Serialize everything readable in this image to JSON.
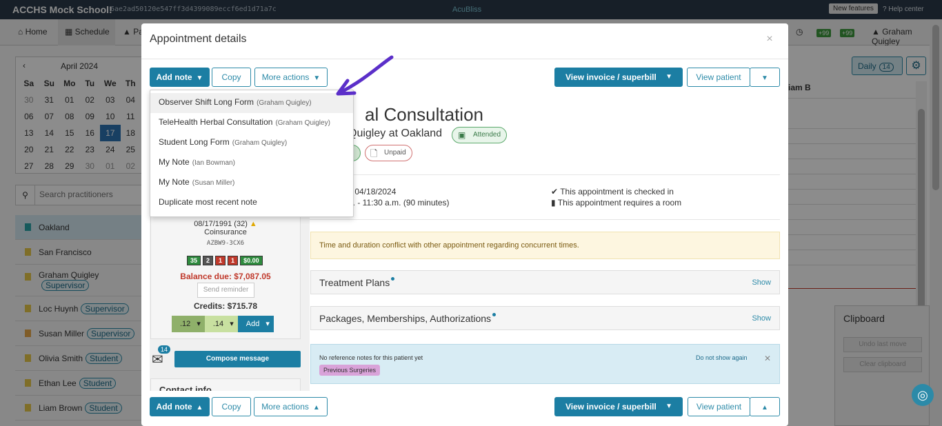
{
  "topbar": {
    "school": "ACCHS Mock School!",
    "hash": "6ae2ad50120e547ff3d4399089eccf6ed1d71a7c",
    "logo": "AcuBliss",
    "new_features": "New features",
    "help": "Help center"
  },
  "nav": {
    "home": "Home",
    "schedule": "Schedule",
    "patients_partial": "Pa",
    "user": "Graham Quigley",
    "badge_a": "+99",
    "badge_b": "+99"
  },
  "calendar": {
    "month": "April 2024",
    "prev": "‹",
    "days": [
      "Sa",
      "Su",
      "Mo",
      "Tu",
      "We",
      "Th"
    ],
    "weeks": [
      [
        {
          "d": "30",
          "g": true
        },
        {
          "d": "31",
          "g": false
        },
        {
          "d": "01",
          "g": false
        },
        {
          "d": "02",
          "g": false
        },
        {
          "d": "03",
          "g": false
        },
        {
          "d": "04",
          "g": false
        }
      ],
      [
        {
          "d": "06",
          "g": false
        },
        {
          "d": "07",
          "g": false
        },
        {
          "d": "08",
          "g": false
        },
        {
          "d": "09",
          "g": false
        },
        {
          "d": "10",
          "g": false
        },
        {
          "d": "11",
          "g": false
        }
      ],
      [
        {
          "d": "13",
          "g": false
        },
        {
          "d": "14",
          "g": false
        },
        {
          "d": "15",
          "g": false
        },
        {
          "d": "16",
          "g": false
        },
        {
          "d": "17",
          "g": false,
          "sel": true
        },
        {
          "d": "18",
          "g": false
        }
      ],
      [
        {
          "d": "20",
          "g": false
        },
        {
          "d": "21",
          "g": false
        },
        {
          "d": "22",
          "g": false
        },
        {
          "d": "23",
          "g": false
        },
        {
          "d": "24",
          "g": false
        },
        {
          "d": "25",
          "g": false
        }
      ],
      [
        {
          "d": "27",
          "g": false
        },
        {
          "d": "28",
          "g": false
        },
        {
          "d": "29",
          "g": false
        },
        {
          "d": "30",
          "g": true
        },
        {
          "d": "01",
          "g": true
        },
        {
          "d": "02",
          "g": true
        }
      ]
    ]
  },
  "practitioner_search": {
    "placeholder": "Search practitioners"
  },
  "practitioners": [
    {
      "name": "Oakland",
      "tag": "",
      "color": "#2aa4a8"
    },
    {
      "name": "San Francisco",
      "tag": "",
      "color": "#e8c84a"
    },
    {
      "name": "Graham Quigley",
      "tag": "Supervisor",
      "color": "#e8c84a",
      "wrap": true
    },
    {
      "name": "Loc Huynh",
      "tag": "Supervisor",
      "color": "#e8c84a"
    },
    {
      "name": "Susan Miller",
      "tag": "Supervisor",
      "color": "#e8a84a"
    },
    {
      "name": "Olivia Smith",
      "tag": "Student",
      "color": "#e8c84a"
    },
    {
      "name": "Ethan Lee",
      "tag": "Student",
      "color": "#e8c84a"
    },
    {
      "name": "Liam Brown",
      "tag": "Student",
      "color": "#e8c84a"
    }
  ],
  "right": {
    "daily": "Daily",
    "daily_count": "14",
    "column_head": "iam B",
    "clipboard_title": "Clipboard",
    "undo": "Undo last move",
    "clear": "Clear clipboard"
  },
  "modal": {
    "title": "Appointment details",
    "close": "×",
    "add_note": "Add note",
    "copy": "Copy",
    "more_actions": "More actions",
    "view_invoice": "View invoice / superbill",
    "view_patient": "View patient"
  },
  "appointment": {
    "title_partial": "al Consultation",
    "sub_partial": "Quigley at Oakland",
    "attended": "Attended",
    "unpaid": "Unpaid",
    "date_partial": "y 04/18/2024",
    "time_partial": "n. - 11:30 a.m. (90 minutes)",
    "checked_in": "This appointment is checked in",
    "needs_room": "This appointment requires a room",
    "warning": "Time and duration conflict with other appointment regarding concurrent times.",
    "treatment_plans": "Treatment Plans",
    "packages": "Packages, Memberships, Authorizations",
    "show": "Show",
    "ref_notes": "No reference notes for this patient yet",
    "previous_surgeries": "Previous Surgeries",
    "do_not_show": "Do not show again"
  },
  "patient": {
    "dob": "08/17/1991 (32)",
    "coinsurance": "Coinsurance",
    "code": "AZBW9-3CX6",
    "stats": [
      {
        "v": "35",
        "c": "#2e8b3e"
      },
      {
        "v": "2",
        "c": "#555"
      },
      {
        "v": "1",
        "c": "#c0392b"
      },
      {
        "v": "1",
        "c": "#c0392b"
      },
      {
        "v": "$0.00",
        "c": "#2e8b3e"
      }
    ],
    "balance": "Balance due: $7,087.05",
    "send_reminder": "Send reminder",
    "credits": "Credits: $715.78",
    "tag1": ".12",
    "tag2": ".14",
    "tag_add": "Add",
    "messages_count": "14",
    "compose": "Compose message",
    "contact": "Contact info"
  },
  "dropdown": [
    {
      "label": "Observer Shift Long Form",
      "who": "(Graham Quigley)",
      "hl": true
    },
    {
      "label": "TeleHealth Herbal Consultation",
      "who": "(Graham Quigley)"
    },
    {
      "label": "Student Long Form",
      "who": "(Graham Quigley)"
    },
    {
      "label": "My Note",
      "who": "(Ian Bowman)"
    },
    {
      "label": "My Note",
      "who": "(Susan Miller)"
    },
    {
      "label": "Duplicate most recent note",
      "who": ""
    }
  ],
  "colors": {
    "primary": "#1c7ea3",
    "arrow": "#5b2fc9"
  }
}
